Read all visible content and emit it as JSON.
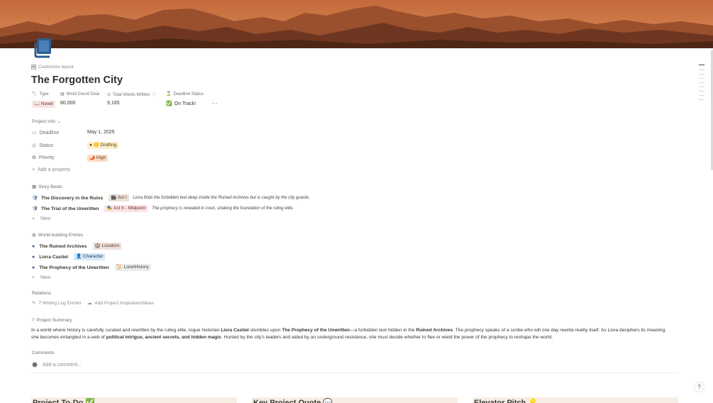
{
  "page": {
    "customize_label": "Customize layout",
    "title": "The Forgotten City"
  },
  "top_props": {
    "headers": {
      "type": "Type",
      "word_count_goal": "Word Count Goal",
      "total_words": "Total Words Written",
      "deadline_status": "Deadline Status"
    },
    "values": {
      "type_emoji": "📖",
      "type": "Novel",
      "word_count_goal": "80,000",
      "total_words": "9,165",
      "deadline_status_emoji": "✅",
      "deadline_status": "On Track!",
      "more": "···"
    }
  },
  "project_info": {
    "heading": "Project Info",
    "deadline_label": "Deadline",
    "deadline_value": "May 1, 2025",
    "status_label": "Status",
    "status_emoji": "🟡",
    "status_value": "Drafting",
    "priority_label": "Priority",
    "priority_emoji": "🌶️",
    "priority_value": "High",
    "add_property": "Add a property"
  },
  "story_beats": {
    "heading": "Story Beats",
    "items": [
      {
        "title": "The Discovery in the Ruins",
        "tag_emoji": "🎬",
        "tag": "Act I",
        "desc": "Liora finds the forbidden text deep inside the Ruined Archives but is caught by the city guards."
      },
      {
        "title": "The Trial of the Unwritten",
        "tag_emoji": "🎭",
        "tag": "Act II - Midpoint",
        "desc": "The prophecy is revealed in court, shaking the foundation of the ruling elite."
      }
    ],
    "new_label": "New"
  },
  "world_building": {
    "heading": "World-building Entries",
    "items": [
      {
        "title": "The Ruined Archives",
        "tag_emoji": "🏰",
        "tag": "Location"
      },
      {
        "title": "Liora Castiel",
        "tag_emoji": "👤",
        "tag": "Character"
      },
      {
        "title": "The Prophecy of the Unwritten",
        "tag_emoji": "📜",
        "tag": "Lore/History"
      }
    ],
    "new_label": "New"
  },
  "relations": {
    "heading": "Relations",
    "writing_log": "7 Writing Log Entries",
    "add_inspiration": "Add Project Inspiration/Ideas"
  },
  "summary": {
    "heading": "Project Summary",
    "p1": "In a world where history is carefully curated and rewritten by the ruling elite, rogue historian ",
    "b1": "Liora Castiel",
    "p2": " stumbles upon ",
    "b2": "The Prophecy of the Unwritten",
    "p3": "—a forbidden text hidden in the ",
    "b3": "Ruined Archives",
    "p4": ". The prophecy speaks of a scribe who will one day rewrite reality itself. As Liora deciphers its meaning, she becomes entangled in a web of ",
    "b4": "political intrigue, ancient secrets, and hidden magic",
    "p5": ". Hunted by the city's leaders and aided by an underground resistance, she must decide whether to flee or wield the power of the prophecy to reshape the world."
  },
  "comments": {
    "heading": "Comments",
    "placeholder": "Add a comment..."
  },
  "cards": [
    {
      "title": "Project To-Do ✅"
    },
    {
      "title": "Key Project Quote 💬"
    },
    {
      "title": "Elevator Pitch 💡"
    }
  ],
  "help_label": "?"
}
